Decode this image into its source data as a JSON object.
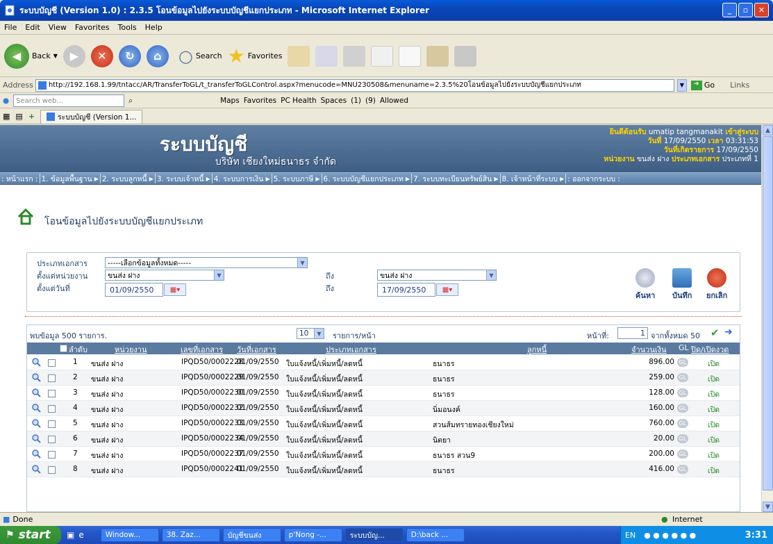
{
  "window": {
    "title": "ระบบบัญชี (Version 1.0) : 2.3.5 โอนข้อมูลไปยังระบบบัญชีแยกประเภท - Microsoft Internet Explorer"
  },
  "menu": [
    "File",
    "Edit",
    "View",
    "Favorites",
    "Tools",
    "Help"
  ],
  "toolbar": {
    "back": "Back",
    "search": "Search",
    "favorites": "Favorites"
  },
  "address": {
    "label": "Address",
    "url": "http://192.168.1.99/tntacc/AR/TransferToGL/t_transferToGLControl.aspx?menucode=MNU230508&menuname=2.3.5%20โอนข้อมูลไปยังระบบบัญชีแยกประเภท",
    "go": "Go",
    "links": "Links"
  },
  "searchbar": {
    "placeholder": "Search web...",
    "items": [
      "Maps",
      "Favorites",
      "PC Health",
      "Spaces",
      "(1)",
      "(9)",
      "Allowed"
    ]
  },
  "tab": {
    "label": "ระบบบัญชี (Version 1..."
  },
  "banner": {
    "brand": "ระบบบัญชี",
    "company": "บริษัท เชียงใหม่ธนาธร จำกัด",
    "welcome_label": "ยินดีต้อนรับ",
    "user": "umatip tangmanakit",
    "login_label": "เข้าสู่ระบบ",
    "day_label": "วันที่",
    "day": "17/09/2550",
    "time_label": "เวลา",
    "time": "03:31:53",
    "txdate_label": "วันที่เกิดรายการ",
    "txdate": "17/09/2550",
    "unit_label": "หน่วยงาน",
    "unit": "ขนส่ง ฝาง",
    "doctype_label": "ประเภทเอกสาร",
    "doctype": "ประเภทที่ 1"
  },
  "nav": [
    ": หน้าแรก :",
    "1. ข้อมูลพื้นฐาน",
    "2. ระบบลูกหนี้",
    "3. ระบบเจ้าหนี้",
    "4. ระบบการเงิน",
    "5. ระบบภาษี",
    "6. ระบบบัญชีแยกประเภท",
    "7. ระบบทะเบียนทรัพย์สิน",
    "8. เจ้าหน้าที่ระบบ",
    ": ออกจากระบบ :"
  ],
  "page": {
    "title": "โอนข้อมูลไปยังระบบบัญชีแยกประเภท"
  },
  "filters": {
    "doctype_label": "ประเภทเอกสาร",
    "doctype_value": "-----เลือกข้อมูลทั้งหมด-----",
    "unit_from_label": "ตั้งแต่หน่วยงาน",
    "unit_from": "ขนส่ง ฝาง",
    "to_label": "ถึง",
    "unit_to": "ขนส่ง ฝาง",
    "date_from_label": "ตั้งแต่วันที่",
    "date_from": "01/09/2550",
    "date_to": "17/09/2550",
    "search_btn": "ค้นหา",
    "save_btn": "บันทึก",
    "cancel_btn": "ยกเลิก"
  },
  "grid": {
    "found": "พบข้อมูล 500 รายการ.",
    "per_page": "10",
    "per_page_label": "รายการ/หน้า",
    "page_label": "หน้าที่:",
    "page": "1",
    "total_label": "จากทั้งหมด 50",
    "headers": [
      "ลำดับ",
      "หน่วยงาน",
      "เลขที่เอกสาร",
      "วันที่เอกสาร",
      "ประเภทเอกสาร",
      "ลูกหนี้",
      "จำนวนเงิน",
      "GL",
      "ปิด/เปิดงวด"
    ],
    "rows": [
      [
        "1",
        "ขนส่ง ฝาง",
        "IPQD50/0002228",
        "01/09/2550",
        "ใบแจ้งหนี้/เพิ่มหนี้/ลดหนี้",
        "ธนาธร",
        "896.00",
        "เปิด"
      ],
      [
        "2",
        "ขนส่ง ฝาง",
        "IPQD50/0002229",
        "01/09/2550",
        "ใบแจ้งหนี้/เพิ่มหนี้/ลดหนี้",
        "ธนาธร",
        "259.00",
        "เปิด"
      ],
      [
        "3",
        "ขนส่ง ฝาง",
        "IPQD50/0002230",
        "01/09/2550",
        "ใบแจ้งหนี้/เพิ่มหนี้/ลดหนี้",
        "ธนาธร",
        "128.00",
        "เปิด"
      ],
      [
        "4",
        "ขนส่ง ฝาง",
        "IPQD50/0002232",
        "01/09/2550",
        "ใบแจ้งหนี้/เพิ่มหนี้/ลดหนี้",
        "นิ่มอนงค์",
        "160.00",
        "เปิด"
      ],
      [
        "5",
        "ขนส่ง ฝาง",
        "IPQD50/0002233",
        "01/09/2550",
        "ใบแจ้งหนี้/เพิ่มหนี้/ลดหนี้",
        "สวนส้มทรายทองเชียงใหม่",
        "760.00",
        "เปิด"
      ],
      [
        "6",
        "ขนส่ง ฝาง",
        "IPQD50/0002234",
        "01/09/2550",
        "ใบแจ้งหนี้/เพิ่มหนี้/ลดหนี้",
        "นิตยา",
        "20.00",
        "เปิด"
      ],
      [
        "7",
        "ขนส่ง ฝาง",
        "IPQD50/0002237",
        "01/09/2550",
        "ใบแจ้งหนี้/เพิ่มหนี้/ลดหนี้",
        "ธนาธร สวน9",
        "200.00",
        "เปิด"
      ],
      [
        "8",
        "ขนส่ง ฝาง",
        "IPQD50/0002241",
        "01/09/2550",
        "ใบแจ้งหนี้/เพิ่มหนี้/ลดหนี้",
        "ธนาธร",
        "416.00",
        "เปิด"
      ]
    ]
  },
  "status": {
    "left": "Done",
    "zone": "Internet"
  },
  "taskbar": {
    "start": "start",
    "tasks": [
      "Window...",
      "38. Zaz...",
      "บัญชีขนส่ง",
      "p'Nong -...",
      "ระบบบัญ...",
      "D:\\back ..."
    ],
    "lang": "EN",
    "clock": "3:31"
  },
  "colors": {
    "banner": "#4d6d93",
    "nav": "#6c8fb6",
    "grid_header": "#5a7aa0",
    "accent_yellow": "#ffd400",
    "open_green": "#1a8a1a"
  }
}
